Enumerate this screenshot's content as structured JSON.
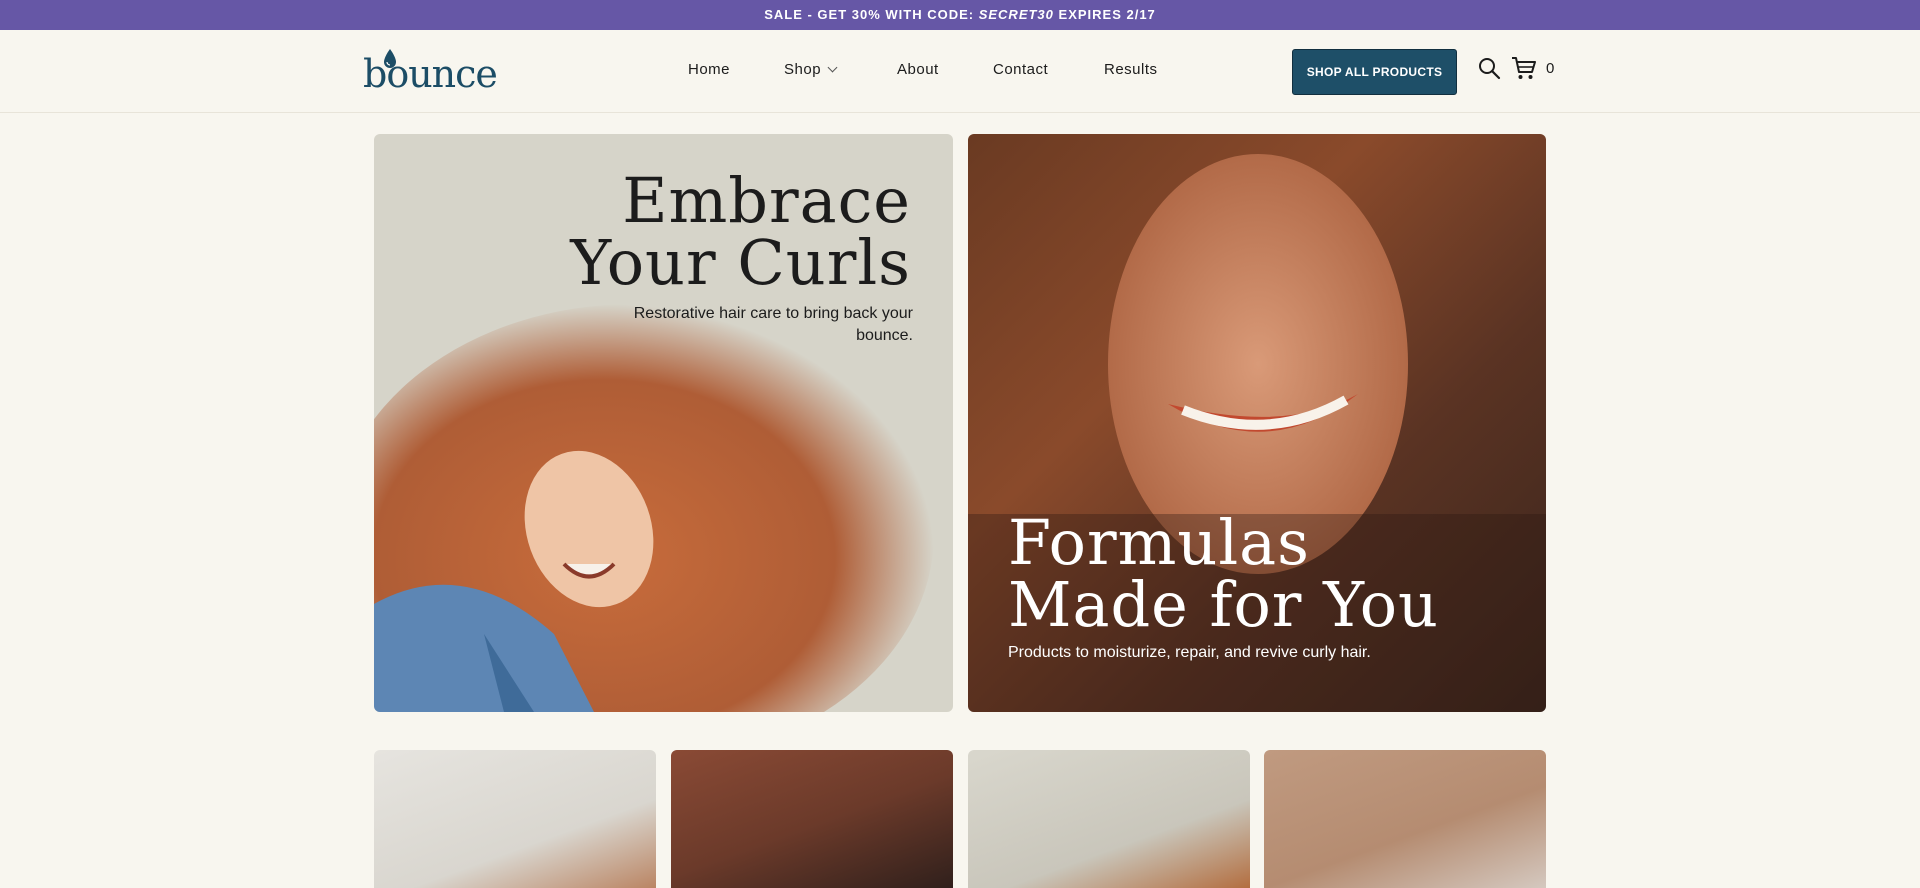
{
  "announcement": {
    "prefix": "SALE - GET 30% WITH CODE: ",
    "code": "SECRET30",
    "suffix": " EXPIRES  2/17"
  },
  "brand": {
    "logo_text": "bounce",
    "accent": "#1e4f68",
    "announce_bg": "#6657a6"
  },
  "nav": {
    "items": [
      "Home",
      "Shop",
      "About",
      "Contact",
      "Results"
    ]
  },
  "header": {
    "cta_label": "SHOP ALL PRODUCTS",
    "cart_count": "0",
    "search_icon": "search-icon",
    "cart_icon": "cart-icon"
  },
  "hero": {
    "left": {
      "title_line1": "Embrace",
      "title_line2": "Your Curls",
      "subtitle": "Restorative hair care to bring back your bounce."
    },
    "right": {
      "title_line1": "Formulas",
      "title_line2": "Made for You",
      "subtitle": "Products to moisturize, repair, and revive curly hair."
    }
  }
}
